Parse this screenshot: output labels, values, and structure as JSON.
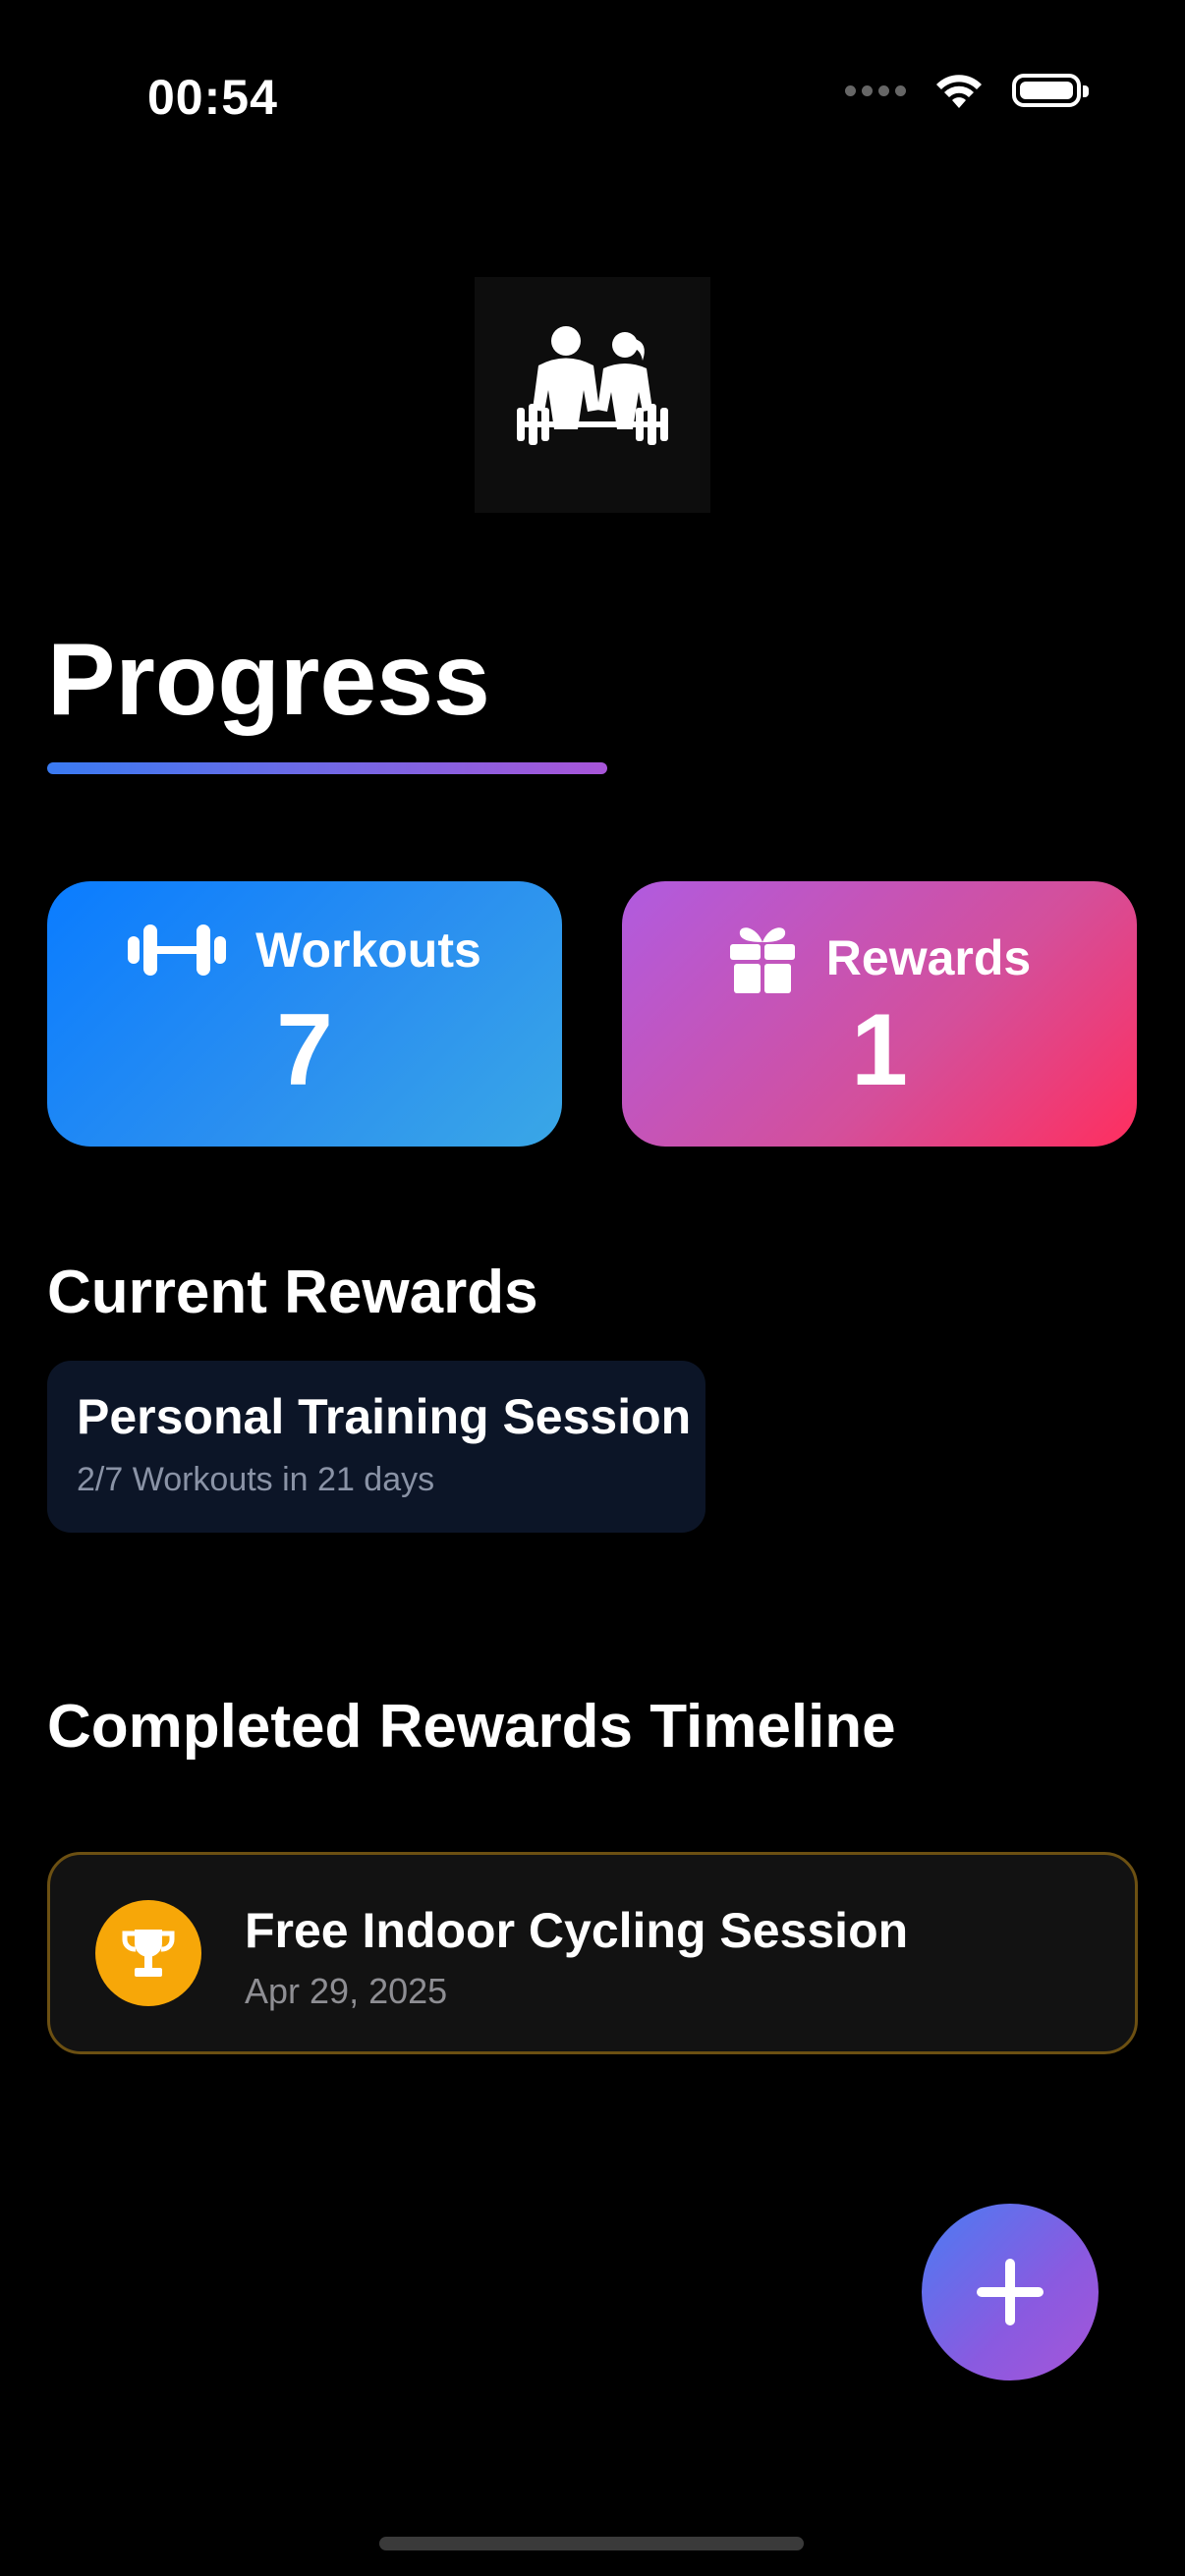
{
  "status_bar": {
    "time": "00:54",
    "icons": [
      "signal-dots-icon",
      "wifi-icon",
      "battery-icon"
    ]
  },
  "logo": {
    "icon": "fitness-couple-logo"
  },
  "page": {
    "title": "Progress"
  },
  "stats": {
    "workouts": {
      "label": "Workouts",
      "value": "7",
      "icon": "dumbbell-icon"
    },
    "rewards": {
      "label": "Rewards",
      "value": "1",
      "icon": "gift-icon"
    }
  },
  "current_rewards": {
    "header": "Current Rewards",
    "items": [
      {
        "title": "Personal Training Session",
        "subtitle": "2/7 Workouts in 21 days"
      }
    ]
  },
  "completed_timeline": {
    "header": "Completed Rewards Timeline",
    "items": [
      {
        "title": "Free Indoor Cycling Session",
        "date": "Apr 29, 2025",
        "icon": "trophy-icon"
      }
    ]
  },
  "fab": {
    "icon": "plus-icon"
  },
  "colors": {
    "background": "#000000",
    "workouts_gradient": [
      "#0a7cff",
      "#3aa7e6"
    ],
    "rewards_gradient": [
      "#b05be0",
      "#ff2e5e"
    ],
    "accent_gradient": [
      "#3a7bf2",
      "#a855d8"
    ],
    "trophy": "#f7a708"
  }
}
